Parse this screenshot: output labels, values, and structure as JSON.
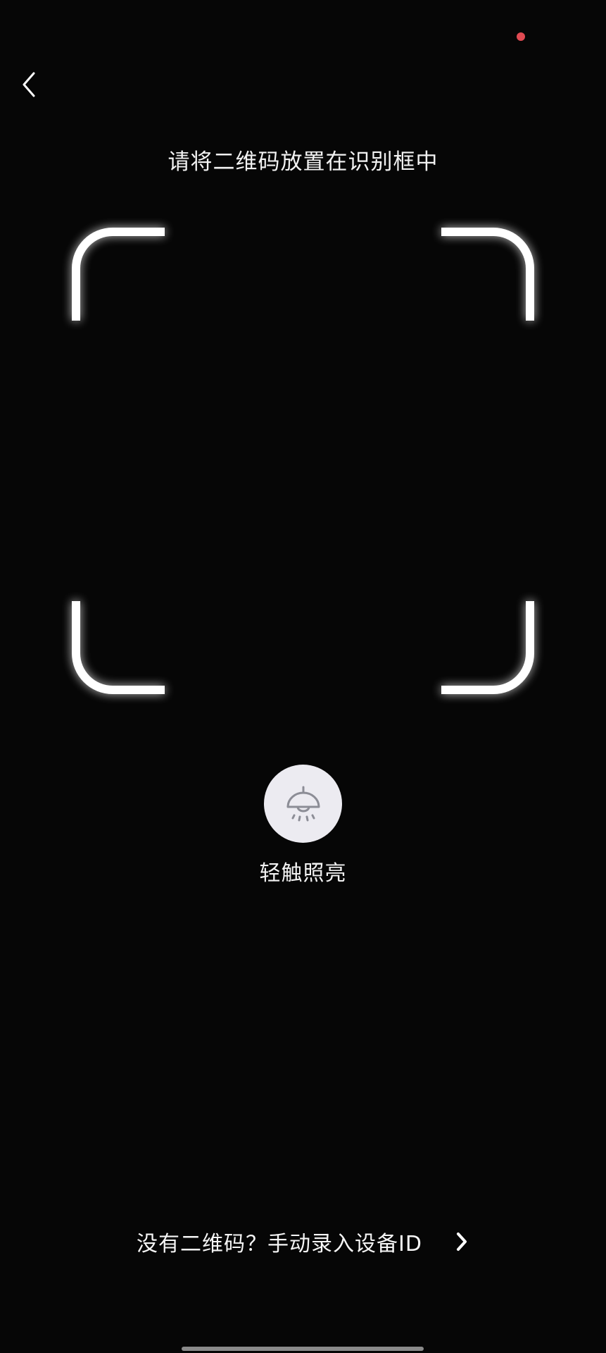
{
  "instruction": "请将二维码放置在识别框中",
  "torch": {
    "label": "轻触照亮",
    "icon": "lamp-icon"
  },
  "manual_entry": {
    "label": "没有二维码？手动录入设备ID",
    "icon": "chevron-right-icon"
  },
  "back": {
    "icon": "chevron-left-icon"
  },
  "colors": {
    "background": "#060606",
    "status_dot": "#e04a52",
    "torch_button": "#ecebf1",
    "icon_gray": "#8c8d96"
  }
}
